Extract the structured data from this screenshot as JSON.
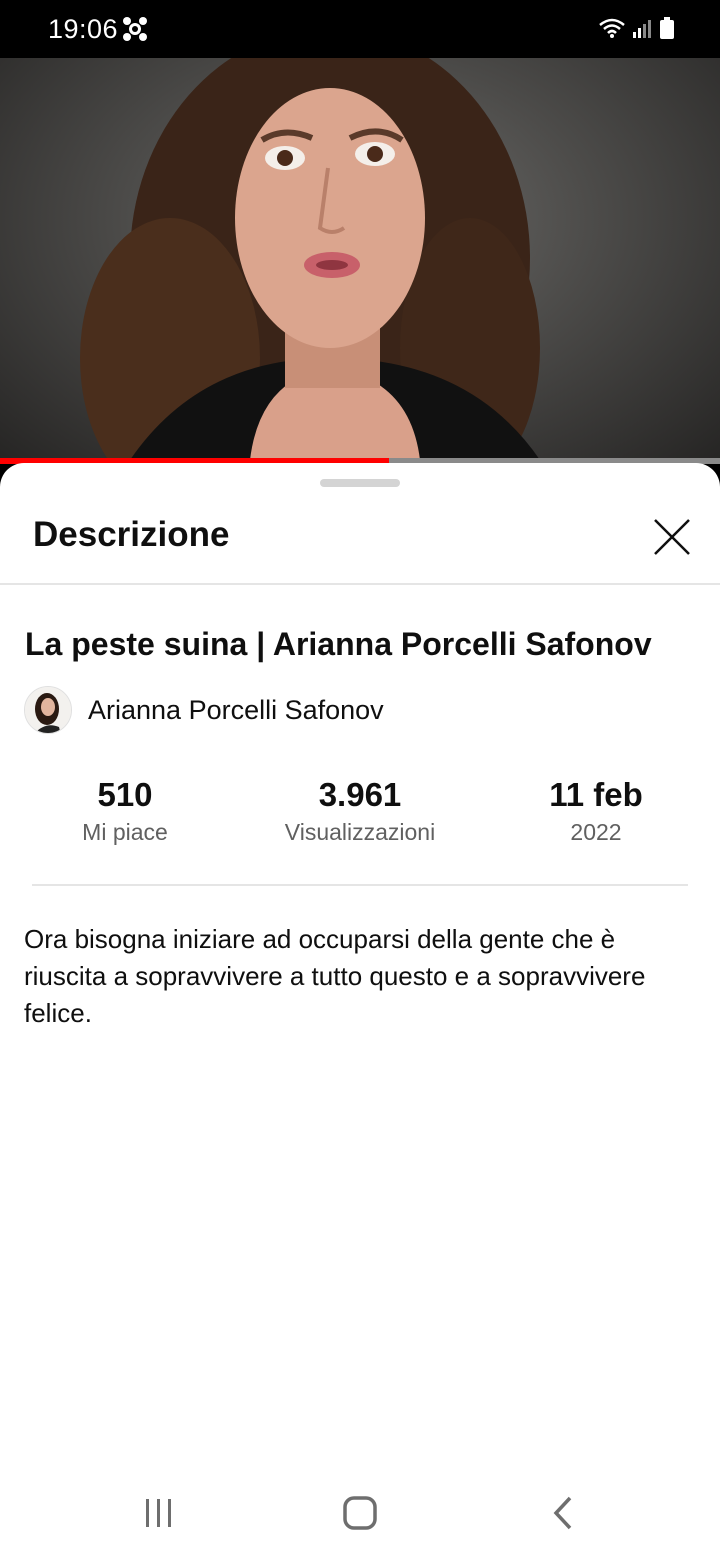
{
  "status_bar": {
    "time": "19:06",
    "icons": [
      "app-notification-icon",
      "wifi-icon",
      "signal-icon",
      "battery-icon"
    ]
  },
  "video": {
    "progress": 0.54
  },
  "description_panel": {
    "title": "Descrizione",
    "close_icon": "close-icon"
  },
  "video_info": {
    "title": "La peste suina | Arianna Porcelli Safonov",
    "channel": "Arianna Porcelli Safonov",
    "stats": [
      {
        "value": "510",
        "label": "Mi piace"
      },
      {
        "value": "3.961",
        "label": "Visualizzazioni"
      },
      {
        "value": "11 feb",
        "label": "2022"
      }
    ],
    "description": "Ora bisogna iniziare ad occuparsi della gente che è riuscita a sopravvivere a tutto questo e a sopravvivere felice."
  },
  "colors": {
    "accent": "#ff0000",
    "text_primary": "#0f0f0f",
    "text_secondary": "#606060"
  },
  "nav": [
    "recent-apps-icon",
    "home-icon",
    "back-icon"
  ]
}
